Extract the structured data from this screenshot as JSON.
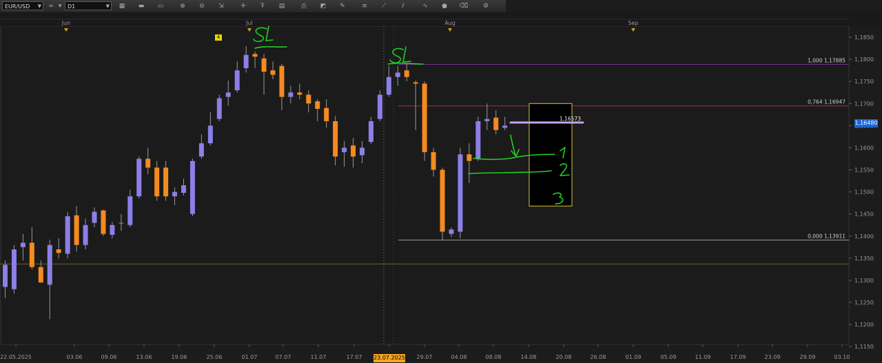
{
  "toolbar": {
    "symbol": "EUR/USD",
    "timeframe": "D1",
    "icons": [
      "chart-type-icon",
      "line-tool-icon",
      "bar-icon",
      "zoom-in-icon",
      "zoom-out-icon",
      "scroll-icon",
      "crosshair-icon",
      "text-tool-icon",
      "template-icon",
      "print-icon",
      "chart-icon",
      "pencil-icon",
      "fibonacci-icon",
      "trendline-icon",
      "channel-icon",
      "wave-icon",
      "sphere-icon",
      "eraser-icon",
      "settings-icon"
    ]
  },
  "overlays": {
    "last_price": "1,16480",
    "highlighted_date": "23.07.2025",
    "event_badge": "4",
    "hline_label": "1,16573"
  },
  "colors": {
    "bull": "#8b7fe8",
    "bear": "#f58a1f",
    "fib_top": "#6e2e8a",
    "fib_mid": "#c0262b",
    "fib_bottom": "#9a9a9a",
    "hline": "#c9a3f0",
    "support": "#6b6333",
    "box": "#d8c53a",
    "annotation": "#22d022",
    "price_tag": "#1b66d1",
    "date_tag": "#f5a623"
  },
  "chart_data": {
    "type": "candlestick",
    "symbol": "EUR/USD",
    "timeframe": "D1",
    "ylim": [
      1.1155,
      1.1875
    ],
    "y_ticks": [
      "1,1850",
      "1,1800",
      "1,1750",
      "1,1700",
      "1,1650",
      "1,1600",
      "1,1550",
      "1,1500",
      "1,1450",
      "1,1400",
      "1,1350",
      "1,1300",
      "1,1250",
      "1,1200",
      "1,1150"
    ],
    "x_ticks": [
      "22.05.2025",
      "03.06",
      "09.06",
      "13.06",
      "19.06",
      "25.06",
      "01.07",
      "07.07",
      "11.07",
      "17.07",
      "23.07.2025",
      "29.07",
      "04.08",
      "08.08",
      "14.08",
      "20.08",
      "26.08",
      "01.09",
      "05.09",
      "11.09",
      "17.09",
      "23.09",
      "29.09",
      "03.10"
    ],
    "months": [
      "Jun",
      "Jul",
      "Aug",
      "Sep"
    ],
    "candles": [
      {
        "o": 1.1285,
        "h": 1.1345,
        "l": 1.126,
        "c": 1.1335
      },
      {
        "o": 1.128,
        "h": 1.138,
        "l": 1.127,
        "c": 1.137
      },
      {
        "o": 1.1375,
        "h": 1.1405,
        "l": 1.1345,
        "c": 1.1385
      },
      {
        "o": 1.1385,
        "h": 1.142,
        "l": 1.1325,
        "c": 1.133
      },
      {
        "o": 1.133,
        "h": 1.1345,
        "l": 1.1295,
        "c": 1.1295
      },
      {
        "o": 1.129,
        "h": 1.1392,
        "l": 1.1212,
        "c": 1.138
      },
      {
        "o": 1.137,
        "h": 1.1395,
        "l": 1.135,
        "c": 1.1362
      },
      {
        "o": 1.136,
        "h": 1.1455,
        "l": 1.135,
        "c": 1.1445
      },
      {
        "o": 1.1447,
        "h": 1.1468,
        "l": 1.1365,
        "c": 1.138
      },
      {
        "o": 1.138,
        "h": 1.144,
        "l": 1.137,
        "c": 1.1425
      },
      {
        "o": 1.143,
        "h": 1.1465,
        "l": 1.142,
        "c": 1.1455
      },
      {
        "o": 1.1458,
        "h": 1.146,
        "l": 1.14,
        "c": 1.1405
      },
      {
        "o": 1.1403,
        "h": 1.1432,
        "l": 1.1395,
        "c": 1.1425
      },
      {
        "o": 1.143,
        "h": 1.145,
        "l": 1.1412,
        "c": 1.143
      },
      {
        "o": 1.1425,
        "h": 1.1505,
        "l": 1.142,
        "c": 1.149
      },
      {
        "o": 1.149,
        "h": 1.158,
        "l": 1.1485,
        "c": 1.1575
      },
      {
        "o": 1.1575,
        "h": 1.16,
        "l": 1.154,
        "c": 1.1555
      },
      {
        "o": 1.1555,
        "h": 1.157,
        "l": 1.148,
        "c": 1.149
      },
      {
        "o": 1.1555,
        "h": 1.157,
        "l": 1.148,
        "c": 1.149
      },
      {
        "o": 1.149,
        "h": 1.151,
        "l": 1.147,
        "c": 1.15
      },
      {
        "o": 1.1498,
        "h": 1.153,
        "l": 1.1492,
        "c": 1.1515
      },
      {
        "o": 1.145,
        "h": 1.1575,
        "l": 1.1445,
        "c": 1.157
      },
      {
        "o": 1.158,
        "h": 1.163,
        "l": 1.1575,
        "c": 1.161
      },
      {
        "o": 1.161,
        "h": 1.168,
        "l": 1.1605,
        "c": 1.165
      },
      {
        "o": 1.1665,
        "h": 1.172,
        "l": 1.166,
        "c": 1.1712
      },
      {
        "o": 1.1715,
        "h": 1.1752,
        "l": 1.1695,
        "c": 1.1725
      },
      {
        "o": 1.173,
        "h": 1.1795,
        "l": 1.1725,
        "c": 1.1775
      },
      {
        "o": 1.178,
        "h": 1.183,
        "l": 1.177,
        "c": 1.181
      },
      {
        "o": 1.1812,
        "h": 1.1818,
        "l": 1.178,
        "c": 1.1806
      },
      {
        "o": 1.1802,
        "h": 1.1812,
        "l": 1.172,
        "c": 1.1772
      },
      {
        "o": 1.1775,
        "h": 1.1795,
        "l": 1.1755,
        "c": 1.1765
      },
      {
        "o": 1.1785,
        "h": 1.179,
        "l": 1.1685,
        "c": 1.1715
      },
      {
        "o": 1.1715,
        "h": 1.174,
        "l": 1.17,
        "c": 1.1725
      },
      {
        "o": 1.1725,
        "h": 1.1745,
        "l": 1.171,
        "c": 1.172
      },
      {
        "o": 1.172,
        "h": 1.173,
        "l": 1.168,
        "c": 1.17
      },
      {
        "o": 1.1705,
        "h": 1.171,
        "l": 1.166,
        "c": 1.1688
      },
      {
        "o": 1.169,
        "h": 1.171,
        "l": 1.1645,
        "c": 1.166
      },
      {
        "o": 1.166,
        "h": 1.1672,
        "l": 1.156,
        "c": 1.158
      },
      {
        "o": 1.159,
        "h": 1.1615,
        "l": 1.1557,
        "c": 1.16
      },
      {
        "o": 1.1605,
        "h": 1.1622,
        "l": 1.1555,
        "c": 1.158
      },
      {
        "o": 1.1583,
        "h": 1.1615,
        "l": 1.1565,
        "c": 1.16
      },
      {
        "o": 1.1613,
        "h": 1.167,
        "l": 1.1608,
        "c": 1.166
      },
      {
        "o": 1.1665,
        "h": 1.173,
        "l": 1.166,
        "c": 1.172
      },
      {
        "o": 1.172,
        "h": 1.1785,
        "l": 1.1715,
        "c": 1.176
      },
      {
        "o": 1.176,
        "h": 1.1785,
        "l": 1.174,
        "c": 1.177
      },
      {
        "o": 1.1775,
        "h": 1.179,
        "l": 1.175,
        "c": 1.176
      },
      {
        "o": 1.1748,
        "h": 1.1752,
        "l": 1.164,
        "c": 1.1745
      },
      {
        "o": 1.1745,
        "h": 1.175,
        "l": 1.157,
        "c": 1.159
      },
      {
        "o": 1.159,
        "h": 1.16,
        "l": 1.1535,
        "c": 1.155
      },
      {
        "o": 1.155,
        "h": 1.1555,
        "l": 1.1391,
        "c": 1.141
      },
      {
        "o": 1.1405,
        "h": 1.142,
        "l": 1.1398,
        "c": 1.1415
      },
      {
        "o": 1.141,
        "h": 1.16,
        "l": 1.1395,
        "c": 1.1585
      },
      {
        "o": 1.1585,
        "h": 1.161,
        "l": 1.152,
        "c": 1.157
      },
      {
        "o": 1.1575,
        "h": 1.167,
        "l": 1.157,
        "c": 1.166
      },
      {
        "o": 1.166,
        "h": 1.17,
        "l": 1.164,
        "c": 1.1665
      },
      {
        "o": 1.1668,
        "h": 1.1685,
        "l": 1.163,
        "c": 1.164
      },
      {
        "o": 1.1645,
        "h": 1.167,
        "l": 1.164,
        "c": 1.165
      }
    ],
    "fib_levels": [
      {
        "label": "1,000 1,17885",
        "value": 1.17885
      },
      {
        "label": "0,764 1,16947",
        "value": 1.16947
      },
      {
        "label": "0,000 1,13911",
        "value": 1.13911
      }
    ],
    "horizontal_lines": [
      1.1657,
      1.1337
    ],
    "annotations": [
      "SL",
      "SL",
      "1",
      "2",
      "3"
    ]
  }
}
